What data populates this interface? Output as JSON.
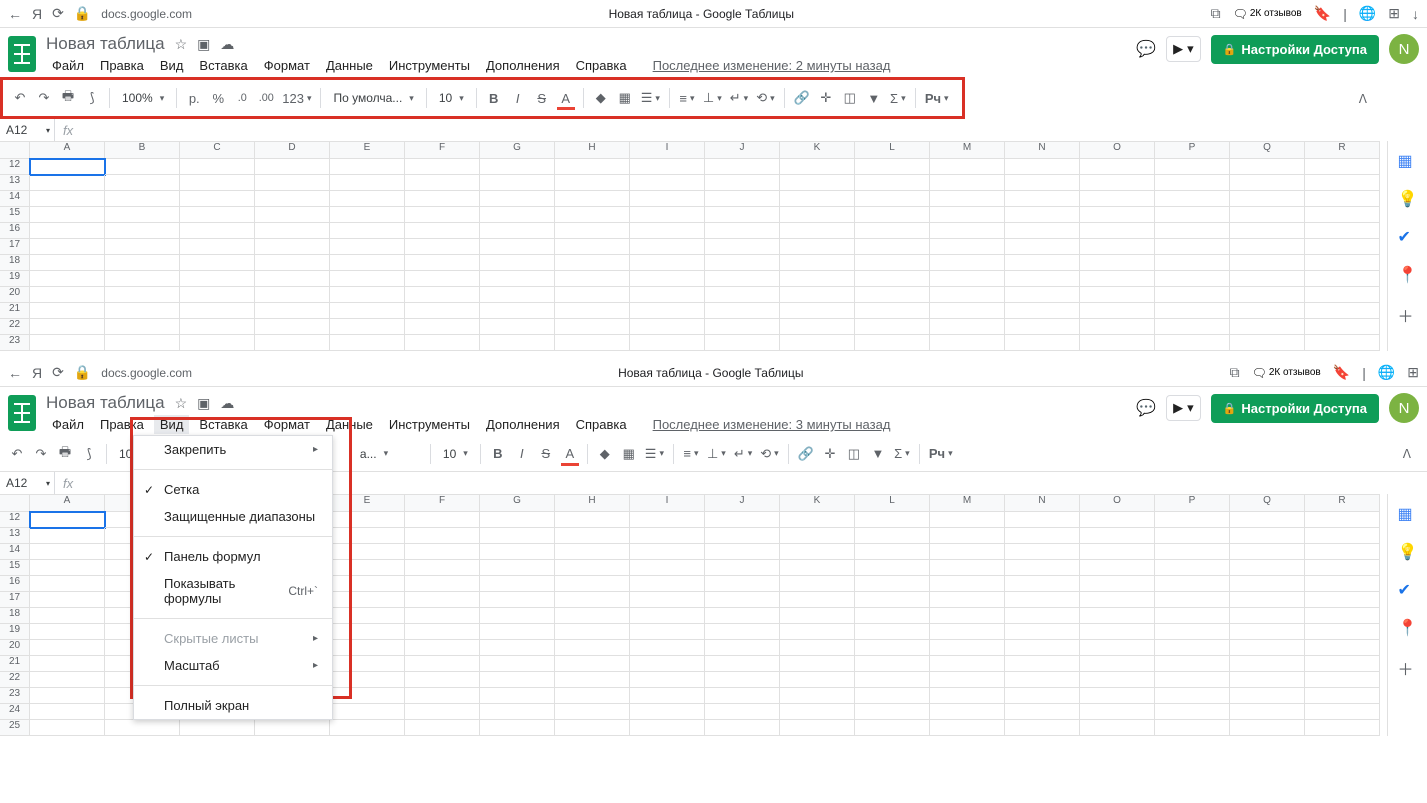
{
  "browser": {
    "url": "docs.google.com",
    "title": "Новая таблица - Google Таблицы",
    "reviews": "2К отзывов"
  },
  "app": {
    "docTitle": "Новая таблица",
    "menus": [
      "Файл",
      "Правка",
      "Вид",
      "Вставка",
      "Формат",
      "Данные",
      "Инструменты",
      "Дополнения",
      "Справка"
    ],
    "lastEdit1": "Последнее изменение: 2 минуты назад",
    "lastEdit2": "Последнее изменение: 3 минуты назад",
    "shareBtn": "Настройки Доступа",
    "avatar": "N"
  },
  "toolbar": {
    "zoom": "100%",
    "currency": "р.",
    "percent": "%",
    "decDec": ".0",
    "incDec": ".00",
    "numFmt": "123",
    "font": "По умолча...",
    "fontSize": "10"
  },
  "nameBox": "A12",
  "columns": [
    "A",
    "B",
    "C",
    "D",
    "E",
    "F",
    "G",
    "H",
    "I",
    "J",
    "K",
    "L",
    "M",
    "N",
    "O",
    "P",
    "Q",
    "R"
  ],
  "rows1": [
    12,
    13,
    14,
    15,
    16,
    17,
    18,
    19,
    20,
    21,
    22,
    23
  ],
  "rows2": [
    12,
    13,
    14,
    15,
    16,
    17,
    18,
    19,
    20,
    21,
    22,
    23,
    24,
    25
  ],
  "viewMenu": {
    "freeze": "Закрепить",
    "gridlines": "Сетка",
    "protected": "Защищенные диапазоны",
    "formulaBar": "Панель формул",
    "showFormulas": "Показывать формулы",
    "showFormulasKey": "Ctrl+`",
    "hiddenSheets": "Скрытые листы",
    "zoom": "Масштаб",
    "fullscreen": "Полный экран"
  }
}
